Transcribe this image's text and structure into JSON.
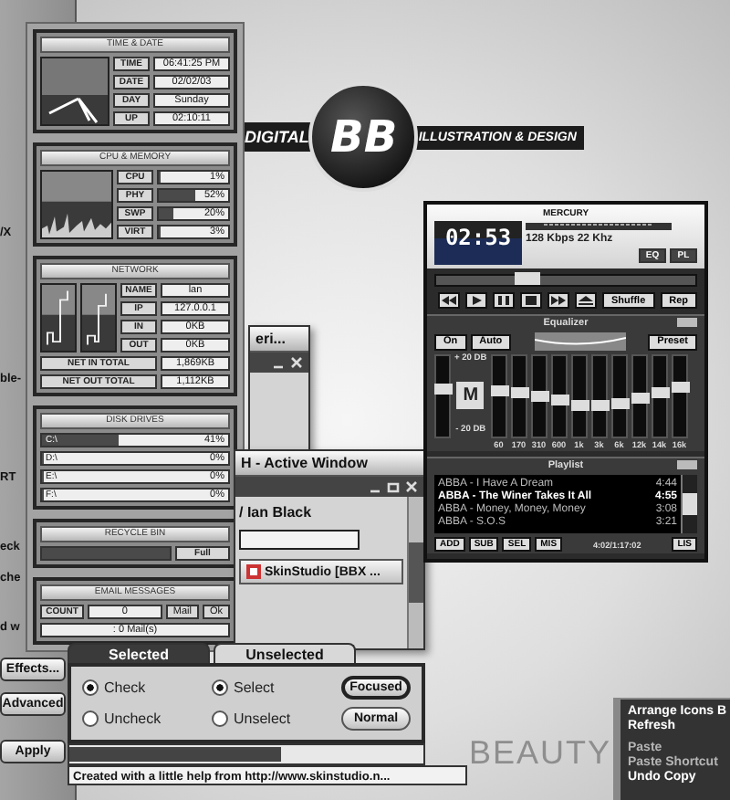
{
  "back_window": {
    "fragments": [
      "/X",
      "ble-",
      "RT",
      "eck",
      "che",
      "d w"
    ],
    "buttons": [
      "Effects...",
      "Advanced",
      "Apply"
    ]
  },
  "monitor": {
    "clock": {
      "title": "TIME & DATE",
      "rows": [
        {
          "label": "TIME",
          "value": "06:41:25 PM"
        },
        {
          "label": "DATE",
          "value": "02/02/03"
        },
        {
          "label": "DAY",
          "value": "Sunday"
        },
        {
          "label": "UP",
          "value": "02:10:11"
        }
      ]
    },
    "cpu": {
      "title": "CPU & MEMORY",
      "rows": [
        {
          "label": "CPU",
          "value": "1%",
          "level": 0.01
        },
        {
          "label": "PHY",
          "value": "52%",
          "level": 0.52
        },
        {
          "label": "SWP",
          "value": "20%",
          "level": 0.2
        },
        {
          "label": "VIRT",
          "value": "3%",
          "level": 0.03
        }
      ]
    },
    "network": {
      "title": "NETWORK",
      "rows": [
        {
          "label": "NAME",
          "value": "lan"
        },
        {
          "label": "IP",
          "value": "127.0.0.1"
        },
        {
          "label": "IN",
          "value": "0KB"
        },
        {
          "label": "OUT",
          "value": "0KB"
        }
      ],
      "totals": [
        {
          "label": "NET IN TOTAL",
          "value": "1,869KB"
        },
        {
          "label": "NET OUT TOTAL",
          "value": "1,112KB"
        }
      ]
    },
    "disks": {
      "title": "DISK DRIVES",
      "rows": [
        {
          "label": "C:\\",
          "value": "41%",
          "level": 0.41
        },
        {
          "label": "D:\\",
          "value": "0%",
          "level": 0
        },
        {
          "label": "E:\\",
          "value": "0%",
          "level": 0
        },
        {
          "label": "F:\\",
          "value": "0%",
          "level": 0
        }
      ]
    },
    "recycle": {
      "title": "RECYCLE BIN",
      "value": "Full",
      "level": 1
    },
    "email": {
      "title": "EMAIL MESSAGES",
      "count_label": "COUNT",
      "count": "0",
      "buttons": [
        "Mail",
        "Ok"
      ],
      "status": ": 0 Mail(s)"
    }
  },
  "logo": {
    "left": "DIGITAL",
    "badge": "BB",
    "right": "ILLUSTRATION & DESIGN"
  },
  "small_window": {
    "title": "eri..."
  },
  "active_window": {
    "title": "H - Active Window",
    "name": "/ Ian Black",
    "task_button": "SkinStudio [BBX ..."
  },
  "demo_window": {
    "tabs": [
      {
        "label": "Selected",
        "selected": true
      },
      {
        "label": "Unselected",
        "selected": false
      }
    ],
    "radios": [
      {
        "label": "Check",
        "selected": true
      },
      {
        "label": "Select",
        "selected": true
      },
      {
        "label": "Uncheck",
        "selected": false
      },
      {
        "label": "Unselect",
        "selected": false
      }
    ],
    "buttons": [
      {
        "label": "Focused",
        "focused": true
      },
      {
        "label": "Normal",
        "focused": false
      }
    ],
    "progress": {
      "level": 0.6
    },
    "status": "Created with a little help from http://www.skinstudio.n..."
  },
  "player": {
    "brand": "MERCURY",
    "time": "02:53",
    "info": "128 Kbps 22 Khz",
    "toggles": [
      {
        "label": "EQ",
        "on": true
      },
      {
        "label": "PL",
        "on": true
      }
    ],
    "seek": {
      "level": 0.3
    },
    "modes": [
      "Shuffle",
      "Rep"
    ],
    "equalizer": {
      "title": "Equalizer",
      "buttons": [
        "On",
        "Auto"
      ],
      "preset": "Preset",
      "max": "+ 20 DB",
      "mark": "M",
      "min": "- 20 DB",
      "preamp": {
        "level": 0.6
      },
      "bands": [
        {
          "label": "60",
          "level": 0.58
        },
        {
          "label": "170",
          "level": 0.55
        },
        {
          "label": "310",
          "level": 0.5
        },
        {
          "label": "600",
          "level": 0.45
        },
        {
          "label": "1k",
          "level": 0.38
        },
        {
          "label": "3k",
          "level": 0.36
        },
        {
          "label": "6k",
          "level": 0.4
        },
        {
          "label": "12k",
          "level": 0.47
        },
        {
          "label": "14k",
          "level": 0.55
        },
        {
          "label": "16k",
          "level": 0.63
        }
      ]
    },
    "playlist": {
      "title": "Playlist",
      "tracks": [
        {
          "title": "ABBA - I Have A Dream",
          "time": "4:44",
          "selected": false
        },
        {
          "title": "ABBA - The Winer Takes It All",
          "time": "4:55",
          "selected": true
        },
        {
          "title": "ABBA - Money, Money, Money",
          "time": "3:08",
          "selected": false
        },
        {
          "title": "ABBA - S.O.S",
          "time": "3:21",
          "selected": false
        }
      ],
      "buttons": [
        "ADD",
        "SUB",
        "SEL",
        "MIS"
      ],
      "total": "4:02/1:17:02",
      "list_button": "LIS"
    }
  },
  "wallpaper": {
    "text": "BEAUTY"
  },
  "context_menu": {
    "items": [
      {
        "kind": "item",
        "label": "Arrange Icons B",
        "disabled": false
      },
      {
        "kind": "item",
        "label": "Refresh",
        "disabled": false
      },
      {
        "kind": "separator"
      },
      {
        "kind": "item",
        "label": "Paste",
        "disabled": true
      },
      {
        "kind": "item",
        "label": "Paste Shortcut",
        "disabled": true
      },
      {
        "kind": "item",
        "label": "Undo Copy",
        "disabled": false
      }
    ]
  }
}
